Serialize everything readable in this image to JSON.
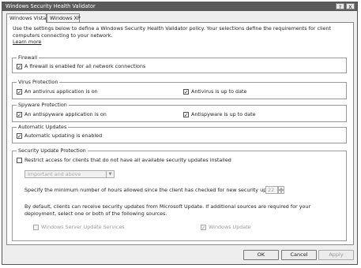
{
  "window": {
    "title": "Windows Security Health Validator",
    "help_button": "?",
    "close_button": "X"
  },
  "tabs": [
    {
      "label": "Windows Vista"
    },
    {
      "label": "Windows XP"
    }
  ],
  "intro": "Use the settings below to define a Windows Security Health Validator policy. Your selections define the requirements for client computers connecting to your network.",
  "learn_more": "Learn more",
  "firewall": {
    "title": "Firewall",
    "checkbox_label": "A firewall is enabled for all network connections",
    "checked": true
  },
  "virus": {
    "title": "Virus Protection",
    "antivirus_label": "An antivirus application is on",
    "antivirus_checked": true,
    "uptodate_label": "Antivirus is up to date",
    "uptodate_checked": true
  },
  "spyware": {
    "title": "Spyware Protection",
    "antispyware_label": "An antispyware application is on",
    "antispyware_checked": true,
    "uptodate_label": "Antispyware is up to date",
    "uptodate_checked": true
  },
  "autoupdate": {
    "title": "Automatic Updates",
    "checkbox_label": "Automatic updating is enabled",
    "checked": true
  },
  "security_updates": {
    "title": "Security Update Protection",
    "restrict_label": "Restrict access for clients that do not have all available security updates installed",
    "restrict_checked": false,
    "severity_value": "Important and above",
    "hours_label": "Specify the minimum number of hours allowed since the client has checked for new security updates:",
    "hours_value": "22",
    "note": "By default, clients can receive security updates from Microsoft Update. If additional sources are required for your deployment, select one or both of the following sources.",
    "wsus_label": "Windows Server Update Services",
    "wsus_checked": false,
    "windows_update_label": "Windows Update",
    "windows_update_checked": true
  },
  "buttons": {
    "ok": "OK",
    "cancel": "Cancel",
    "apply": "Apply"
  }
}
